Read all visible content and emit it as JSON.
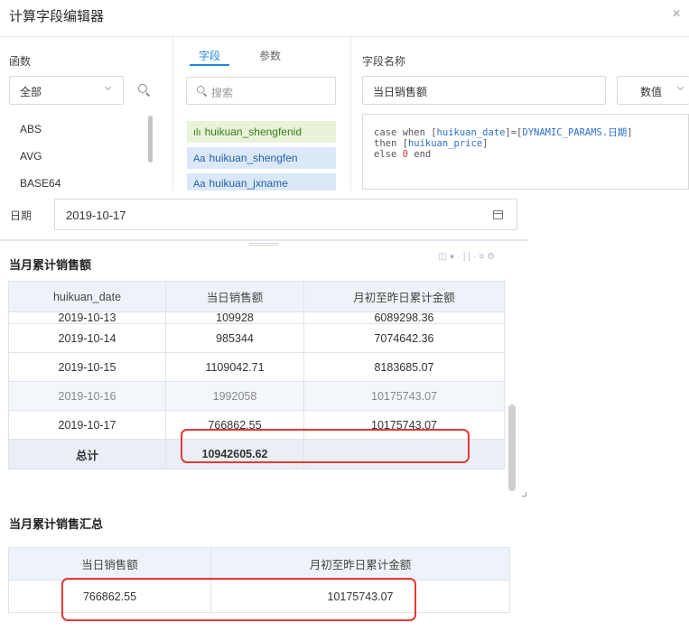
{
  "dialog": {
    "title": "计算字段编辑器",
    "close_glyph": "×"
  },
  "functions": {
    "label": "函数",
    "category_selected": "全部",
    "items": [
      "ABS",
      "AVG",
      "BASE64"
    ]
  },
  "fields_panel": {
    "tabs": [
      "字段",
      "参数"
    ],
    "active_tab": "字段",
    "search_placeholder": "搜索",
    "items": [
      {
        "icon": "bar-chart-icon",
        "icon_glyph": "ılı",
        "name": "huikuan_shengfenid",
        "kind": "dimension"
      },
      {
        "icon": "text-field-icon",
        "icon_glyph": "Aa",
        "name": "huikuan_shengfen",
        "kind": "text"
      },
      {
        "icon": "text-field-icon",
        "icon_glyph": "Aa",
        "name": "huikuan_jxname",
        "kind": "text"
      }
    ]
  },
  "field_editor": {
    "name_label": "字段名称",
    "name_value": "当日销售额",
    "type_value": "数值",
    "code": {
      "l1_a": "case when [",
      "l1_field": "huikuan_date",
      "l1_b": "]=[",
      "l1_param": "DYNAMIC_PARAMS.日期",
      "l1_c": "]",
      "l2_a": "then [",
      "l2_field": "huikuan_price",
      "l2_b": "]",
      "l3_a": "else ",
      "l3_num": "0",
      "l3_b": " end"
    }
  },
  "date_filter": {
    "label": "日期",
    "value": "2019-10-17"
  },
  "panel1": {
    "title": "当月累计销售额",
    "tool_icons": [
      "export-icon",
      "info-icon",
      "split-icon",
      "table-icon",
      "settings-icon"
    ],
    "columns": [
      "huikuan_date",
      "当日销售额",
      "月初至昨日累计金额"
    ],
    "rows": [
      [
        "2019-10-13",
        "109928",
        "6089298.36"
      ],
      [
        "2019-10-14",
        "985344",
        "7074642.36"
      ],
      [
        "2019-10-15",
        "1109042.71",
        "8183685.07"
      ],
      [
        "2019-10-16",
        "1992058",
        "10175743.07"
      ],
      [
        "2019-10-17",
        "766862.55",
        "10175743.07"
      ]
    ],
    "total": [
      "总计",
      "10942605.62",
      ""
    ]
  },
  "panel2": {
    "title": "当月累计销售汇总",
    "columns": [
      "当日销售额",
      "月初至昨日累计金额"
    ],
    "row": [
      "766862.55",
      "10175743.07"
    ]
  },
  "colors": {
    "accent": "#1e88e5",
    "highlight": "#e53935",
    "header_bg": "#eef3fa"
  }
}
